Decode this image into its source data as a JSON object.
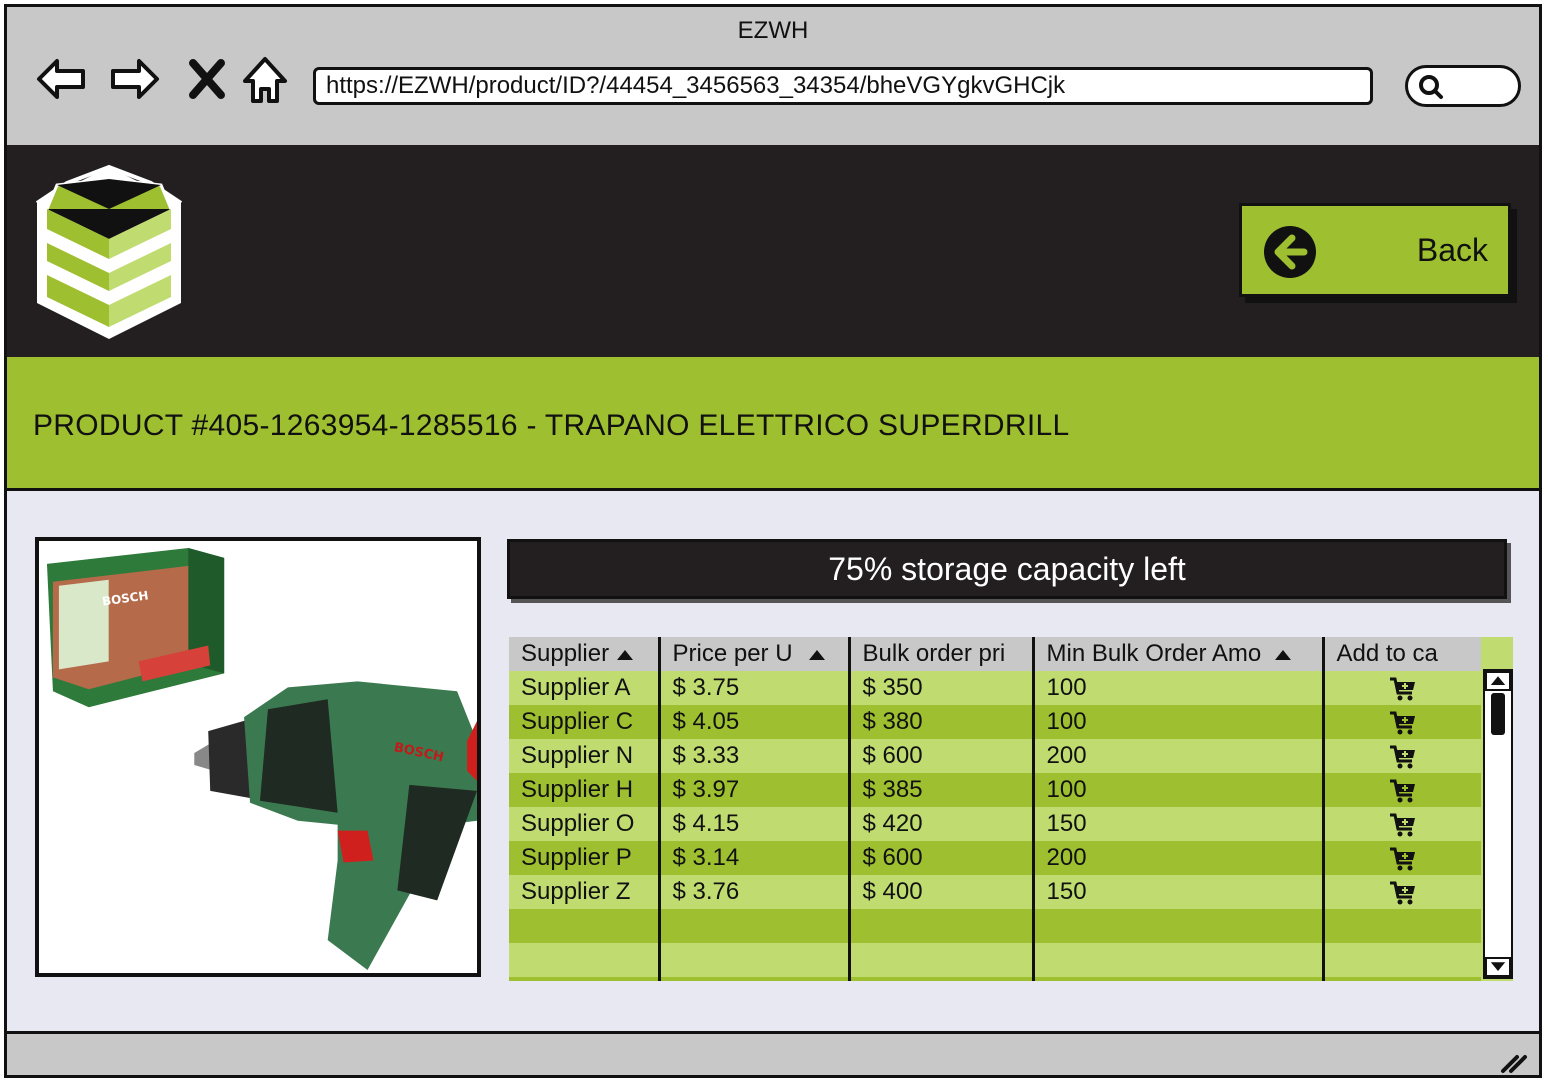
{
  "window": {
    "title": "EZWH"
  },
  "browser": {
    "url": "https://EZWH/product/ID?/44454_3456563_34354/bheVGYgkvGHCjk"
  },
  "header": {
    "back_label": "Back"
  },
  "product": {
    "title": "PRODUCT #405-1263954-1285516 - TRAPANO ELETTRICO SUPERDRILL",
    "image_brand": "BOSCH"
  },
  "storage": {
    "capacity_text": "75% storage capacity left"
  },
  "table": {
    "headers": [
      "Supplier",
      "Price per U",
      "Bulk order pri",
      "Min Bulk Order Amo",
      "Add to ca"
    ],
    "rows": [
      [
        "Supplier A",
        "$ 3.75",
        "$ 350",
        "100"
      ],
      [
        "Supplier C",
        "$ 4.05",
        "$ 380",
        "100"
      ],
      [
        "Supplier N",
        "$ 3.33",
        "$ 600",
        "200"
      ],
      [
        "Supplier H",
        "$ 3.97",
        "$ 385",
        "100"
      ],
      [
        "Supplier O",
        "$ 4.15",
        "$ 420",
        "150"
      ],
      [
        "Supplier P",
        "$ 3.14",
        "$ 600",
        "200"
      ],
      [
        "Supplier Z",
        "$ 3.76",
        "$ 400",
        "150"
      ]
    ]
  },
  "colors": {
    "accent_green": "#9ebf2f",
    "light_green": "#c0dc70",
    "dark": "#231f20",
    "chrome_gray": "#c8c8c8",
    "content_bg": "#e8e8f2"
  }
}
